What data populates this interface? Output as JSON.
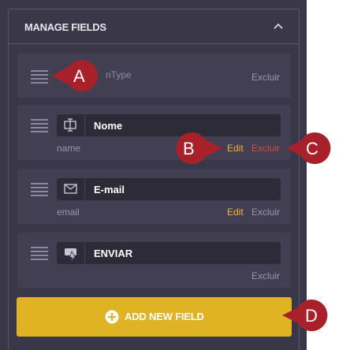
{
  "panel": {
    "title": "MANAGE FIELDS",
    "collapse_icon": "chevron-up-icon"
  },
  "fields": [
    {
      "type_label": "nType",
      "delete_label": "Excluir"
    },
    {
      "icon": "text-cursor-icon",
      "label": "Nome",
      "name": "name",
      "edit_label": "Edit",
      "delete_label": "Excluir"
    },
    {
      "icon": "envelope-icon",
      "label": "E-mail",
      "name": "email",
      "edit_label": "Edit",
      "delete_label": "Excluir"
    },
    {
      "icon": "submit-button-icon",
      "label": "ENVIAR",
      "delete_label": "Excluir"
    }
  ],
  "add_button": {
    "label": "ADD NEW FIELD",
    "icon": "plus-circle-icon"
  },
  "callouts": [
    "A",
    "B",
    "C",
    "D"
  ],
  "colors": {
    "panel_bg": "#3a3848",
    "row_bg": "#413f51",
    "accent": "#e0b325",
    "edit": "#f0b42c",
    "delete_highlight": "#d84a4a",
    "callout": "#a8202a"
  }
}
